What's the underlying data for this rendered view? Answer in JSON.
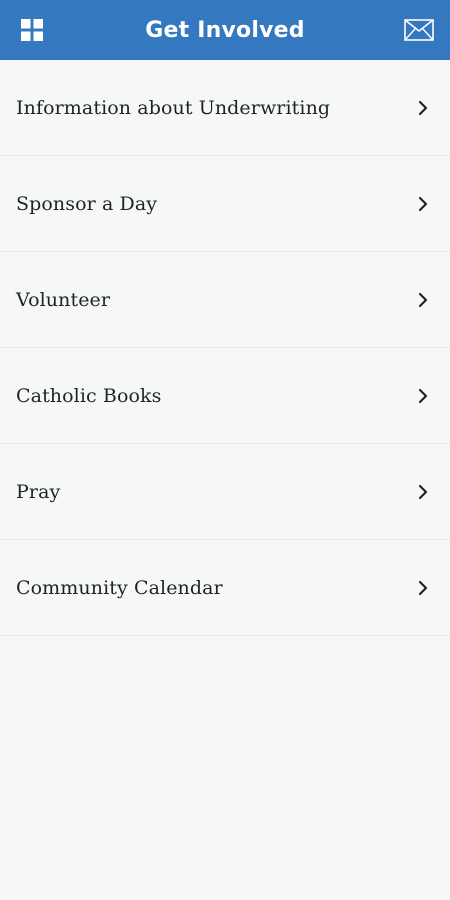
{
  "header": {
    "title": "Get Involved",
    "left_icon": "grid-menu-icon",
    "right_icon": "mail-icon",
    "background_color": "#3478bf"
  },
  "menu": {
    "items": [
      {
        "label": "Information about Underwriting",
        "icon": "chevron-right-icon"
      },
      {
        "label": "Sponsor a Day",
        "icon": "chevron-right-icon"
      },
      {
        "label": "Volunteer",
        "icon": "chevron-right-icon"
      },
      {
        "label": "Catholic Books",
        "icon": "chevron-right-icon"
      },
      {
        "label": "Pray",
        "icon": "chevron-right-icon"
      },
      {
        "label": "Community Calendar",
        "icon": "chevron-right-icon"
      }
    ]
  }
}
